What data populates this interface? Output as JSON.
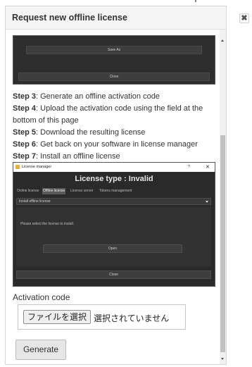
{
  "dialog": {
    "title": "Request new offline license",
    "close_glyph": "✖"
  },
  "screenshot_top": {
    "save_as_label": "Save As",
    "close_label": "Close"
  },
  "steps": [
    {
      "label": "Step 3",
      "text": ": Generate an offline activation code"
    },
    {
      "label": "Step 4",
      "text": ": Upload the activation code using the field at the"
    },
    {
      "label": "",
      "text": "bottom of this page"
    },
    {
      "label": "Step 5",
      "text": ": Download the resulting license"
    },
    {
      "label": "Step 6",
      "text": ": Get back on your software in license manager"
    },
    {
      "label": "Step 7",
      "text": ": Install an offline license"
    }
  ],
  "license_manager": {
    "window_title": "License manager",
    "help_glyph": "?",
    "close_glyph": "✕",
    "heading": "License type : Invalid",
    "tabs": [
      "Online license",
      "Offline license",
      "License server",
      "Tokens management"
    ],
    "active_tab": "Offline license",
    "selected_option": "Install offline license",
    "note": "Please select the license to install.",
    "open_label": "Open",
    "close_label": "Close"
  },
  "activation": {
    "label": "Activation code",
    "file_button": "ファイルを選択",
    "file_status": "選択されていません"
  },
  "generate_label": "Generate",
  "colors": {
    "header_bg": "#f5f5f5",
    "screenshot_bg": "#2a2a2a",
    "button_bg": "#e6e6e6"
  }
}
